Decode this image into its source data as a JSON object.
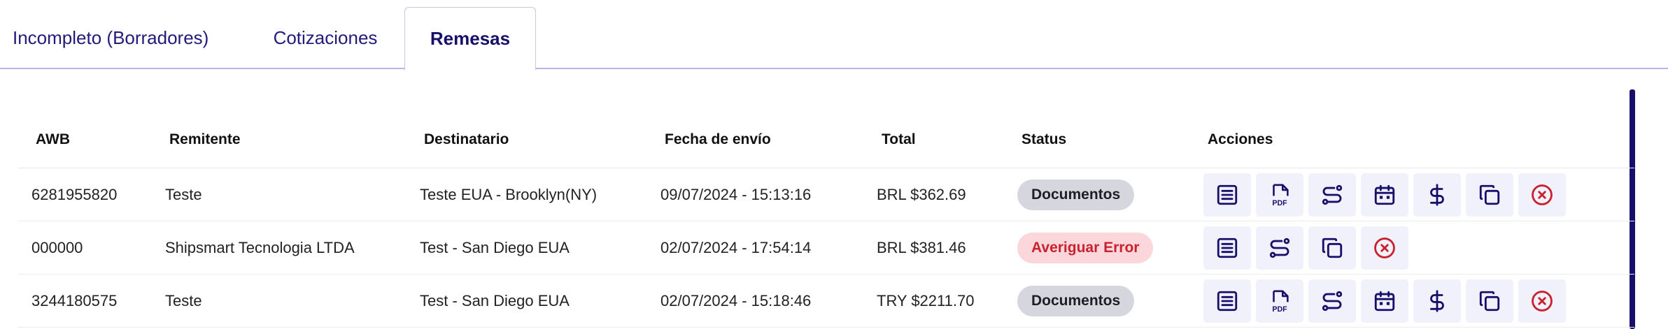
{
  "tabs": [
    {
      "label": "Incompleto (Borradores)",
      "active": false
    },
    {
      "label": "Cotizaciones",
      "active": false
    },
    {
      "label": "Remesas",
      "active": true
    }
  ],
  "table": {
    "headers": {
      "awb": "AWB",
      "remitente": "Remitente",
      "destinatario": "Destinatario",
      "fecha": "Fecha de envío",
      "total": "Total",
      "status": "Status",
      "acciones": "Acciones"
    },
    "rows": [
      {
        "awb": "6281955820",
        "remitente": "Teste",
        "destinatario": "Teste EUA - Brooklyn(NY)",
        "fecha": "09/07/2024 - 15:13:16",
        "total": "BRL $362.69",
        "status": "Documentos",
        "status_type": "neutral",
        "actions": [
          "list-icon",
          "pdf-icon",
          "route-icon",
          "calendar-icon",
          "dollar-icon",
          "copy-icon",
          "cancel-icon"
        ]
      },
      {
        "awb": "000000",
        "remitente": "Shipsmart Tecnologia LTDA",
        "destinatario": "Test - San Diego EUA",
        "fecha": "02/07/2024 - 17:54:14",
        "total": "BRL $381.46",
        "status": "Averiguar Error",
        "status_type": "error",
        "actions": [
          "list-icon",
          "route-icon",
          "copy-icon",
          "cancel-icon"
        ]
      },
      {
        "awb": "3244180575",
        "remitente": "Teste",
        "destinatario": "Test - San Diego EUA",
        "fecha": "02/07/2024 - 15:18:46",
        "total": "TRY $2211.70",
        "status": "Documentos",
        "status_type": "neutral",
        "actions": [
          "list-icon",
          "pdf-icon",
          "route-icon",
          "calendar-icon",
          "dollar-icon",
          "copy-icon",
          "cancel-icon"
        ]
      }
    ]
  },
  "colors": {
    "primary": "#16106b",
    "tab_text": "#221b7a",
    "action_bg": "#f1f1fb",
    "danger": "#c8222f",
    "badge_neutral": "#d6d6de",
    "badge_error": "#fbd7dc"
  }
}
